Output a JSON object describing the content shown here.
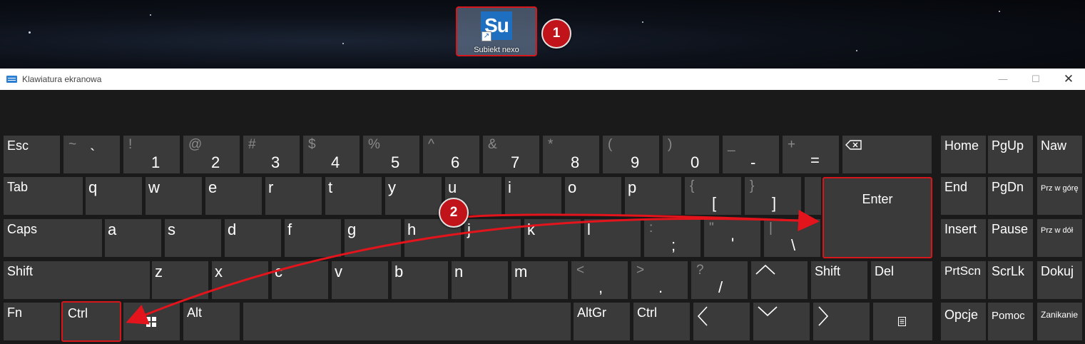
{
  "desktop": {
    "icon_logo": "Su",
    "icon_label": "Subiekt nexo",
    "callouts": [
      "1",
      "2"
    ]
  },
  "window": {
    "title": "Klawiatura ekranowa",
    "minimize_icon": "minimize-icon",
    "maximize_icon": "maximize-icon",
    "close_icon": "close-icon"
  },
  "keys": {
    "esc": "Esc",
    "tilde": {
      "shift": "~",
      "main": "`"
    },
    "d1": {
      "shift": "!",
      "main": "1"
    },
    "d2": {
      "shift": "@",
      "main": "2"
    },
    "d3": {
      "shift": "#",
      "main": "3"
    },
    "d4": {
      "shift": "$",
      "main": "4"
    },
    "d5": {
      "shift": "%",
      "main": "5"
    },
    "d6": {
      "shift": "^",
      "main": "6"
    },
    "d7": {
      "shift": "&",
      "main": "7"
    },
    "d8": {
      "shift": "*",
      "main": "8"
    },
    "d9": {
      "shift": "(",
      "main": "9"
    },
    "d0": {
      "shift": ")",
      "main": "0"
    },
    "minus": {
      "shift": "_",
      "main": "-"
    },
    "equals": {
      "shift": "+",
      "main": "="
    },
    "backspace_icon": "backspace-icon",
    "tab": "Tab",
    "q": "q",
    "w": "w",
    "e": "e",
    "r": "r",
    "t": "t",
    "y": "y",
    "u": "u",
    "i": "i",
    "o": "o",
    "p": "p",
    "lbracket": {
      "shift": "{",
      "main": "["
    },
    "rbracket": {
      "shift": "}",
      "main": "]"
    },
    "enter": "Enter",
    "caps": "Caps",
    "a": "a",
    "s": "s",
    "d": "d",
    "f": "f",
    "g": "g",
    "h": "h",
    "j": "j",
    "k": "k",
    "l": "l",
    "semicolon": {
      "shift": ":",
      "main": ";"
    },
    "quote": {
      "shift": "\"",
      "main": "'"
    },
    "backslash": {
      "shift": "|",
      "main": "\\"
    },
    "shift": "Shift",
    "z": "z",
    "x": "x",
    "c": "c",
    "v": "v",
    "b": "b",
    "n": "n",
    "m": "m",
    "comma": {
      "shift": "<",
      "main": ","
    },
    "period": {
      "shift": ">",
      "main": "."
    },
    "slash": {
      "shift": "?",
      "main": "/"
    },
    "up_icon": "arrow-up-icon",
    "shift_right": "Shift",
    "del": "Del",
    "fn": "Fn",
    "ctrl": "Ctrl",
    "win_icon": "windows-icon",
    "alt": "Alt",
    "altgr": "AltGr",
    "ctrl_right": "Ctrl",
    "left_icon": "arrow-left-icon",
    "down_icon": "arrow-down-icon",
    "right_icon": "arrow-right-icon",
    "menu_icon": "context-menu-icon",
    "home": "Home",
    "pgup": "PgUp",
    "naw": "Naw",
    "end": "End",
    "pgdn": "PgDn",
    "przwgore": "Prz w górę",
    "insert": "Insert",
    "pause": "Pause",
    "przwdol": "Prz w dół",
    "prtscn": "PrtScn",
    "scrlk": "ScrLk",
    "dokuj": "Dokuj",
    "opcje": "Opcje",
    "pomoc": "Pomoc",
    "zanikanie": "Zanikanie"
  },
  "colors": {
    "highlight": "#d5161b",
    "key": "#3a3a3a",
    "background": "#1a1a1a",
    "arrow": "#e3141b"
  }
}
